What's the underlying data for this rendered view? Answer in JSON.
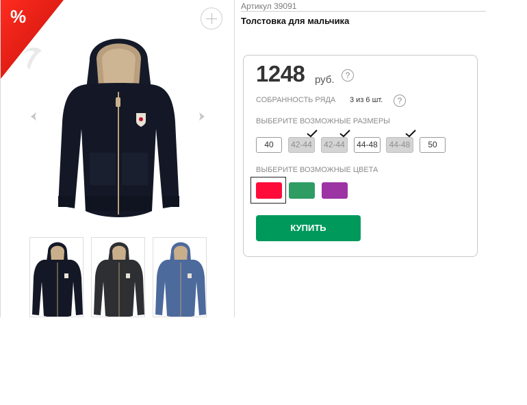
{
  "gallery": {
    "sale_badge": "%",
    "zoom_icon": "plus-icon",
    "prev_icon": "chevron-left-icon",
    "next_icon": "chevron-right-icon",
    "thumbnails": [
      {
        "color": "#141826"
      },
      {
        "color": "#2d2f33"
      },
      {
        "color": "#4d6a9c"
      }
    ]
  },
  "product": {
    "sku": "Артикул 39091",
    "title": "Толстовка для мальчика"
  },
  "panel": {
    "price": "1248",
    "currency": "руб.",
    "help_mark": "?",
    "set_label": "СОБРАННОСТЬ РЯДА",
    "set_value": "3 из 6 шт.",
    "sizes_label": "ВЫБЕРИТЕ  ВОЗМОЖНЫЕ РАЗМЕРЫ",
    "sizes": [
      {
        "label": "40",
        "available": true,
        "checked": false
      },
      {
        "label": "42-44",
        "available": false,
        "checked": true
      },
      {
        "label": "42-44",
        "available": false,
        "checked": true
      },
      {
        "label": "44-48",
        "available": true,
        "checked": false
      },
      {
        "label": "44-48",
        "available": false,
        "checked": true
      },
      {
        "label": "50",
        "available": true,
        "checked": false
      }
    ],
    "colors_label": "ВЫБЕРИТЕ ВОЗМОЖНЫЕ ЦВЕТА",
    "colors": [
      "#ff0b3a",
      "#2e9c63",
      "#9c34a3"
    ],
    "selected_color_index": 0,
    "buy_label": "КУПИТЬ",
    "buy_color": "#00995c"
  }
}
